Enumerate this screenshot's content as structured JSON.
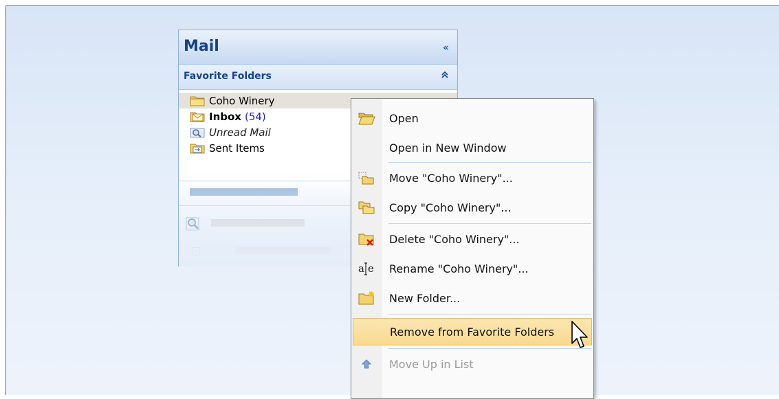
{
  "mail_pane": {
    "title": "Mail",
    "collapse_glyph": "«",
    "favorite_header": "Favorite Folders",
    "favorite_chevron": "⌃",
    "folders": [
      {
        "name": "Coho Winery",
        "icon": "folder-icon",
        "selected": true
      },
      {
        "name": "Inbox",
        "count": "(54)",
        "icon": "inbox-icon",
        "bold": true
      },
      {
        "name": "Unread Mail",
        "icon": "search-folder-icon",
        "italic": true
      },
      {
        "name": "Sent Items",
        "icon": "sent-items-icon"
      }
    ]
  },
  "context_menu": {
    "items": [
      {
        "label": "Open",
        "icon": "open-folder-icon"
      },
      {
        "label": "Open in New Window",
        "icon": ""
      },
      {
        "label": "Move \"Coho Winery\"...",
        "icon": "move-folder-icon"
      },
      {
        "label": "Copy \"Coho Winery\"...",
        "icon": "copy-folder-icon"
      },
      {
        "label": "Delete \"Coho Winery\"...",
        "icon": "delete-folder-icon"
      },
      {
        "label": "Rename \"Coho Winery\"...",
        "icon": "rename-icon"
      },
      {
        "label": "New Folder...",
        "icon": "new-folder-icon"
      },
      {
        "label": "Remove from Favorite Folders",
        "icon": "",
        "highlighted": true
      },
      {
        "label": "Move Up in List",
        "icon": "arrow-up-icon",
        "disabled": true
      }
    ]
  },
  "colors": {
    "accent": "#15428b",
    "highlight": "#f9d98e",
    "count": "#2222c8"
  }
}
